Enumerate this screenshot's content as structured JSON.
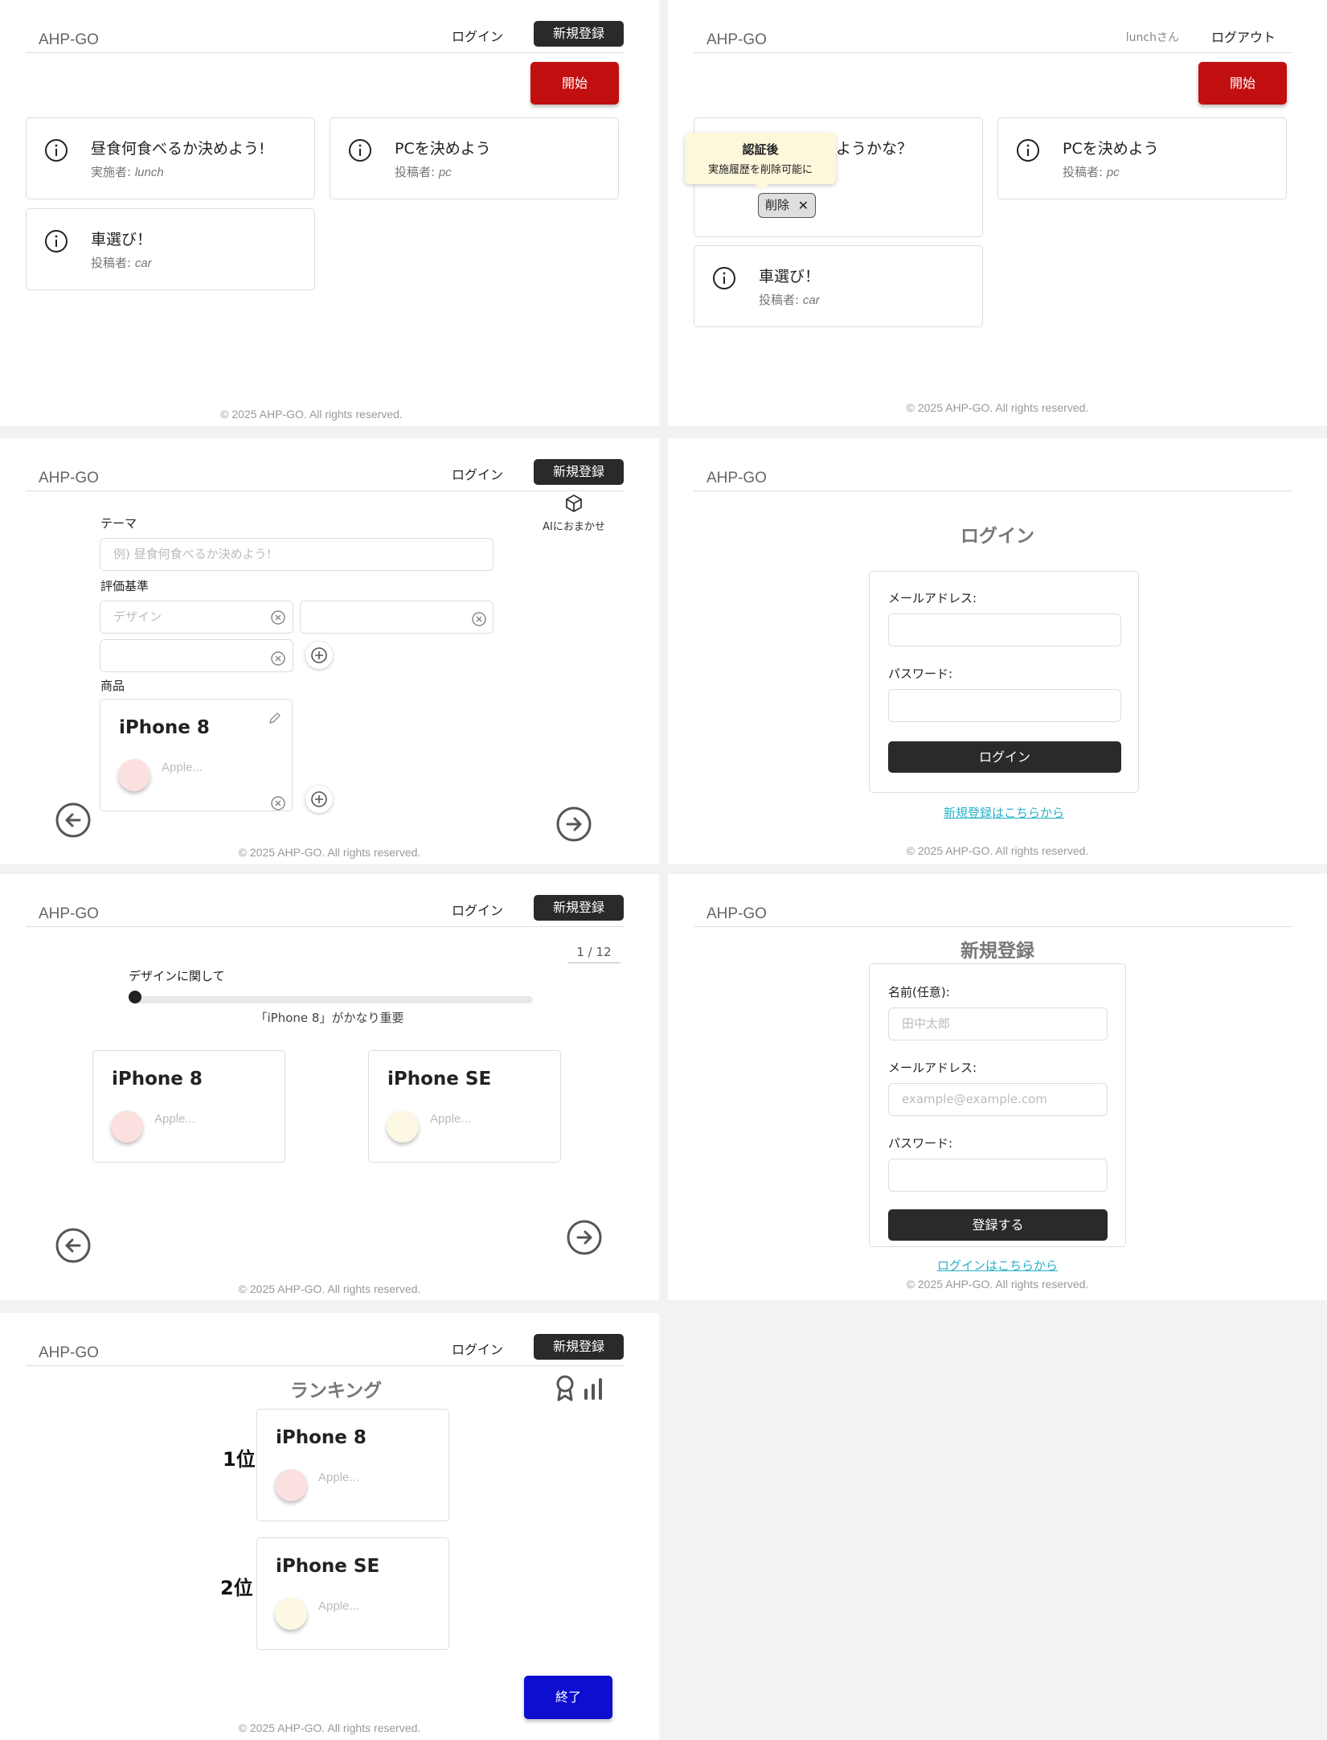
{
  "brand": "AHP-GO",
  "header": {
    "login_label": "ログイン",
    "register_label": "新規登録",
    "user_label": "lunchさん",
    "logout_label": "ログアウト"
  },
  "footer": "© 2025 AHP-GO. All rights reserved.",
  "home": {
    "start_label": "開始",
    "cards": [
      {
        "title": "昼食何食べるか決めよう!",
        "sub_prefix": "実施者: ",
        "sub_value": "lunch"
      },
      {
        "title": "PCを決めよう",
        "sub_prefix": "投稿者: ",
        "sub_value": "pc"
      },
      {
        "title": "車選び！",
        "sub_prefix": "投稿者: ",
        "sub_value": "car"
      }
    ]
  },
  "home_logged_in": {
    "start_label": "開始",
    "partial_title": "ようかな？",
    "tooltip_title": "認証後",
    "tooltip_body": "実施履歴を削除可能に",
    "delete_label": "削除",
    "delete_x": "✕",
    "cards": [
      {
        "title": "PCを決めよう",
        "sub_prefix": "投稿者: ",
        "sub_value": "pc"
      },
      {
        "title": "車選び！",
        "sub_prefix": "投稿者: ",
        "sub_value": "car"
      }
    ]
  },
  "create": {
    "ai_label": "AIにおまかせ",
    "theme_label": "テーマ",
    "theme_placeholder": "例) 昼食何食べるか決めよう!",
    "criteria_label": "評価基準",
    "criteria_placeholder": "デザイン",
    "products_label": "商品",
    "product_name": "iPhone 8",
    "product_brand": "Apple..."
  },
  "login": {
    "title": "ログイン",
    "email_label": "メールアドレス:",
    "password_label": "パスワード:",
    "submit_label": "ログイン",
    "register_link": "新規登録はこちらから"
  },
  "compare": {
    "counter": "1 / 12",
    "criterion_label": "デザインに関して",
    "result_text": "「iPhone 8」がかなり重要",
    "products": [
      {
        "name": "iPhone 8",
        "brand": "Apple...",
        "color": "#fbe0e0"
      },
      {
        "name": "iPhone SE",
        "brand": "Apple...",
        "color": "#fdf8e3"
      }
    ],
    "slider_value": 0
  },
  "register": {
    "title": "新規登録",
    "name_label": "名前(任意):",
    "name_placeholder": "田中太郎",
    "email_label": "メールアドレス:",
    "email_placeholder": "example@example.com",
    "password_label": "パスワード:",
    "submit_label": "登録する",
    "login_link": "ログインはこちらから"
  },
  "ranking": {
    "title": "ランキング",
    "items": [
      {
        "rank": "1位",
        "name": "iPhone 8",
        "brand": "Apple..."
      },
      {
        "rank": "2位",
        "name": "iPhone SE",
        "brand": "Apple..."
      }
    ],
    "end_label": "終了"
  },
  "colors": {
    "start_red": "#c10f0f",
    "end_blue": "#0d0ed0",
    "dark_button": "#2a2a2a",
    "link": "#2ab0c8",
    "pink_dot": "#fbe0e0",
    "cream_dot": "#fdf8e3"
  }
}
